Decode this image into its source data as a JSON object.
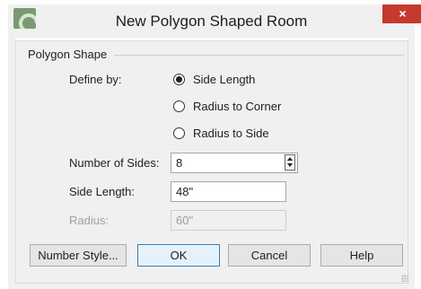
{
  "window": {
    "title": "New Polygon Shaped Room",
    "close_symbol": "×",
    "app_icon": "app-logo-icon"
  },
  "group": {
    "label": "Polygon Shape"
  },
  "define_by": {
    "label": "Define by:",
    "options": [
      {
        "label": "Side Length",
        "selected": true
      },
      {
        "label": "Radius to Corner",
        "selected": false
      },
      {
        "label": "Radius to Side",
        "selected": false
      }
    ]
  },
  "number_of_sides": {
    "label": "Number of Sides:",
    "value": "8"
  },
  "side_length": {
    "label": "Side Length:",
    "value": "48\""
  },
  "radius": {
    "label": "Radius:",
    "value": "60\"",
    "disabled": true
  },
  "buttons": {
    "number_style": "Number Style...",
    "ok": "OK",
    "cancel": "Cancel",
    "help": "Help"
  },
  "colors": {
    "close_button": "#c7392c",
    "default_button_border": "#3c7fb1"
  }
}
